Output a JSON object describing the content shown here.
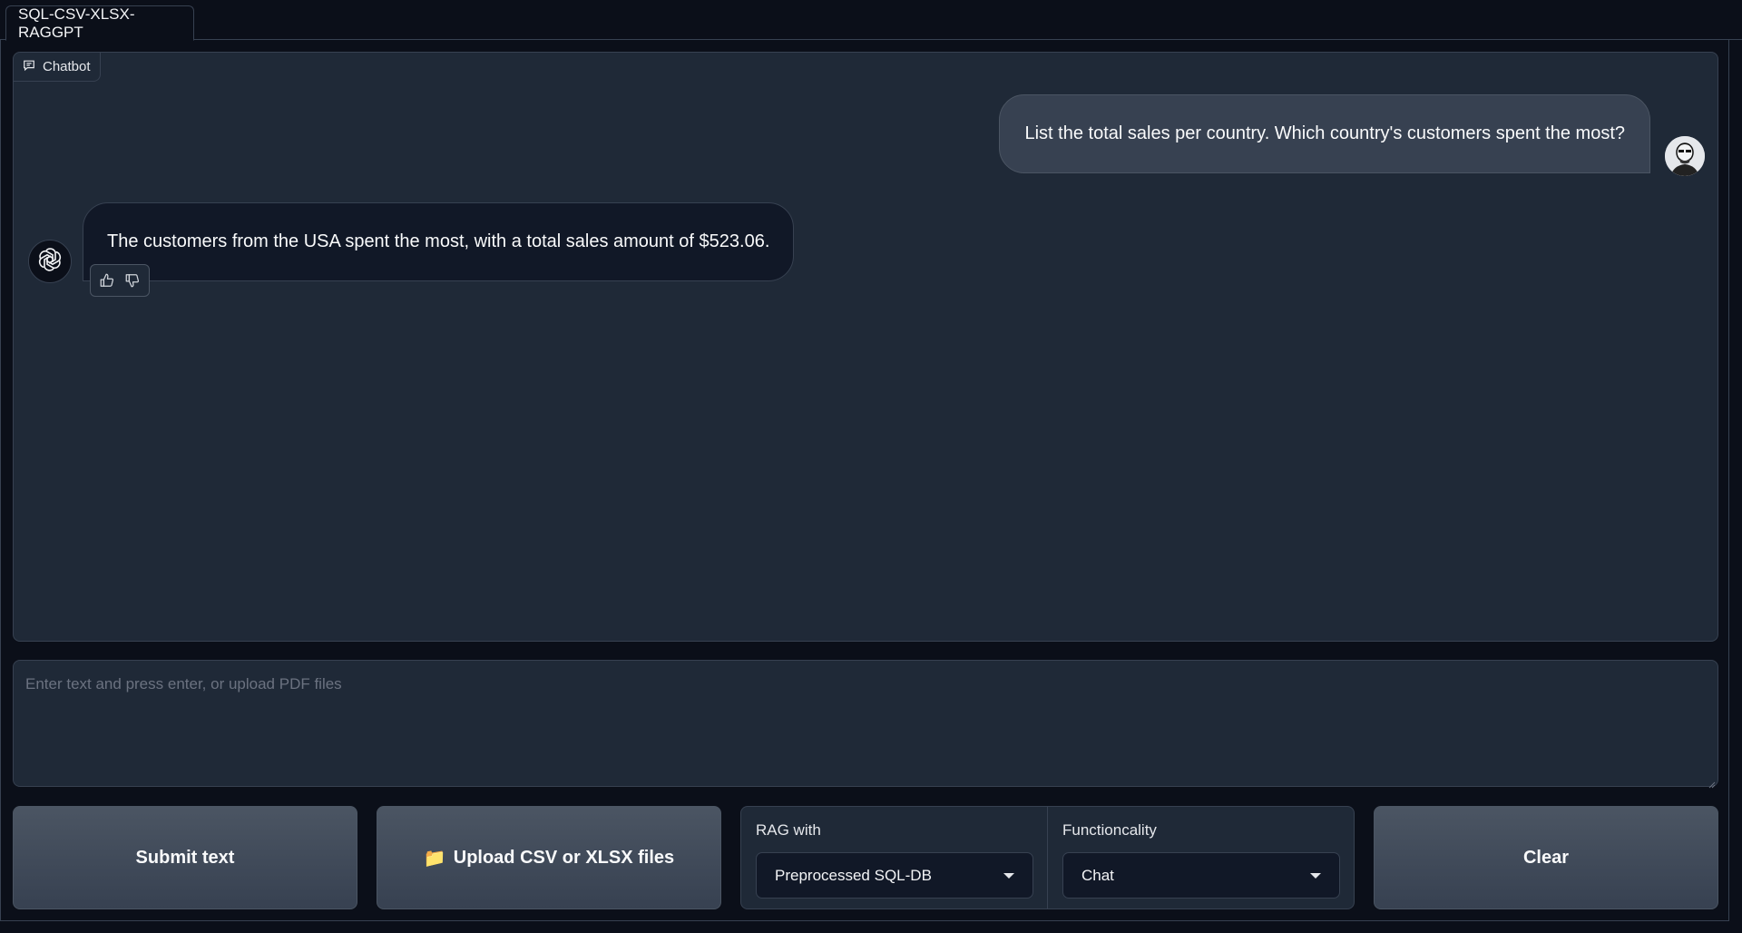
{
  "tabs": [
    {
      "label": "SQL-CSV-XLSX-RAGGPT",
      "active": true
    }
  ],
  "chatbot": {
    "label": "Chatbot",
    "messages": [
      {
        "role": "user",
        "text": "List the total sales per country. Which country's customers spent the most?"
      },
      {
        "role": "assistant",
        "text": "The customers from the USA spent the most, with a total sales amount of $523.06."
      }
    ]
  },
  "input": {
    "placeholder": "Enter text and press enter, or upload PDF files",
    "value": ""
  },
  "buttons": {
    "submit": "Submit text",
    "upload_icon": "📁",
    "upload": "Upload CSV or XLSX files",
    "clear": "Clear"
  },
  "dropdowns": [
    {
      "label": "RAG with",
      "value": "Preprocessed SQL-DB"
    },
    {
      "label": "Functioncality",
      "value": "Chat"
    }
  ],
  "icons": [
    "chat-bubble-icon",
    "user-avatar",
    "openai-logo-icon",
    "thumbs-up-icon",
    "thumbs-down-icon",
    "folder-icon",
    "caret-down-icon"
  ],
  "colors": {
    "background": "#0b0f19",
    "panel": "#1f2937",
    "border": "#374151",
    "button": "#4b5563"
  }
}
